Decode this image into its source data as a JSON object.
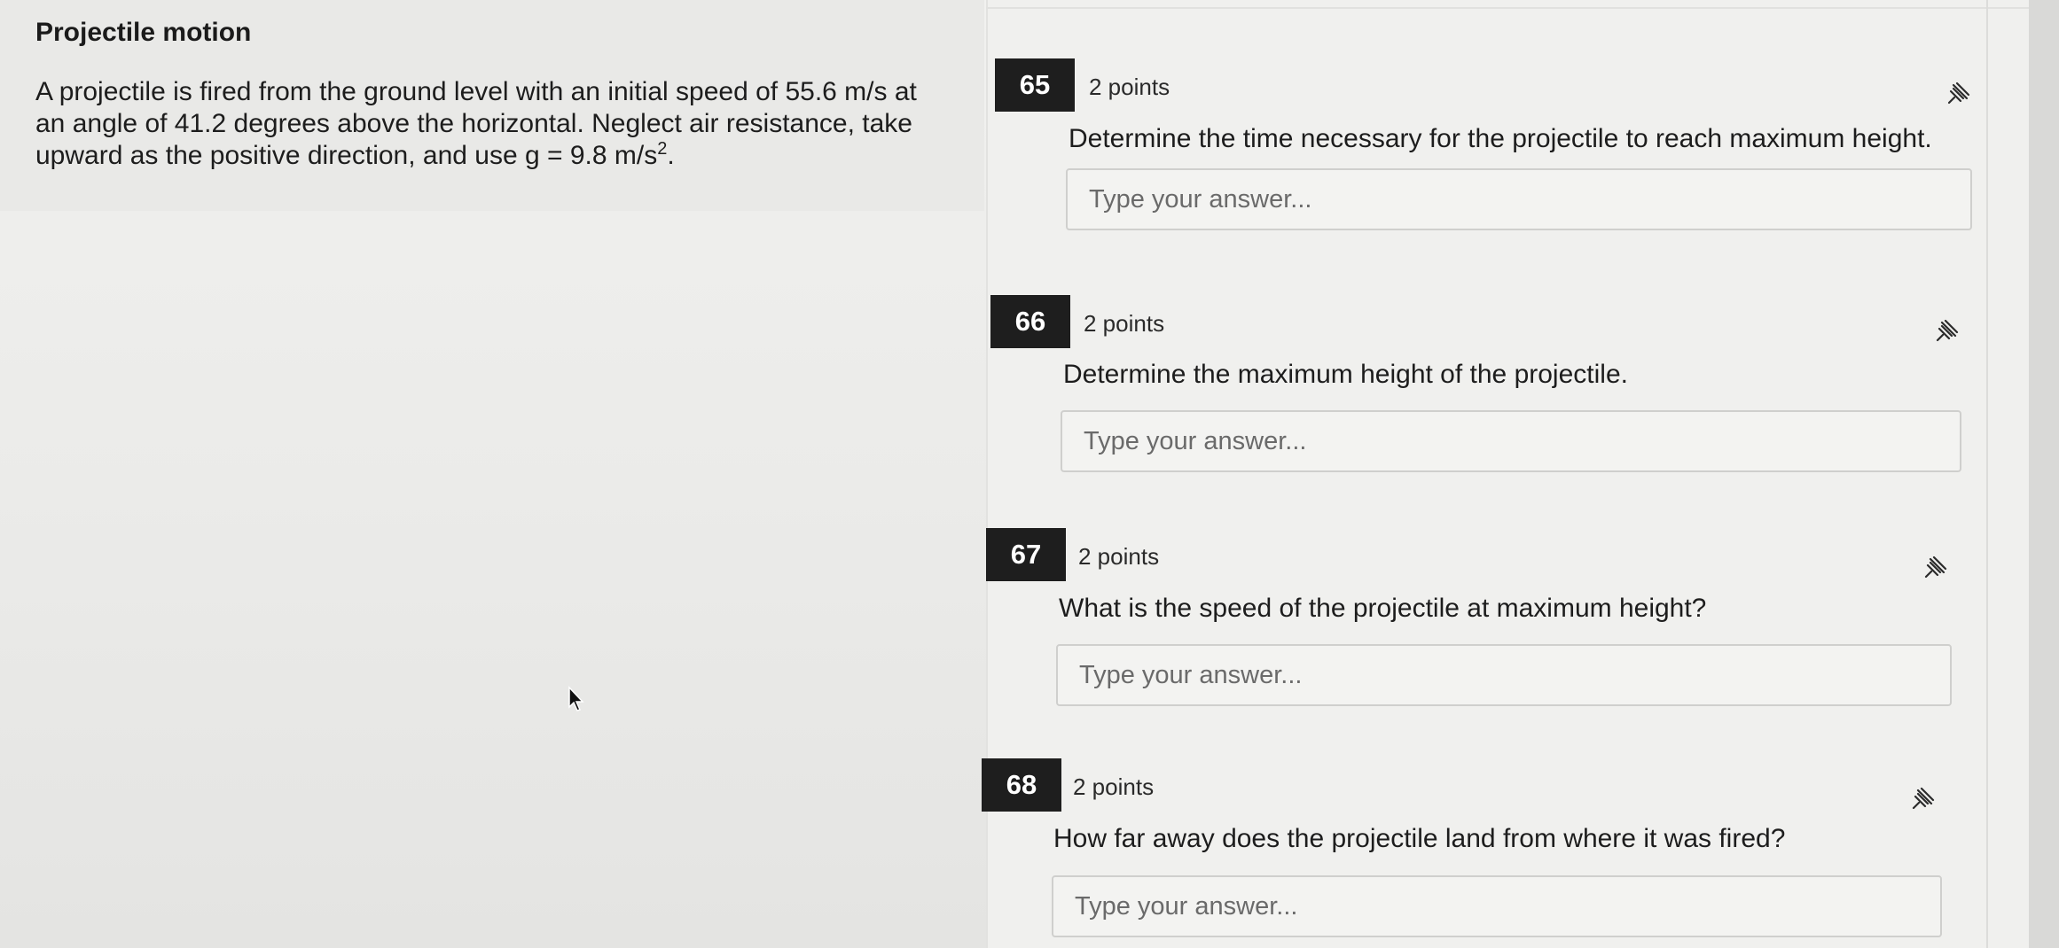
{
  "context": {
    "title": "Projectile motion",
    "text_main": "A projectile is fired from the ground level with an initial speed of 55.6 m/s at an angle of 41.2 degrees above the horizontal. Neglect air resistance, take upward as the positive direction, and use g = 9.8 m/s",
    "exponent": "2",
    "period": "."
  },
  "questions": [
    {
      "number": "65",
      "points": "2 points",
      "text": "Determine the time necessary for the projectile to reach maximum height.",
      "placeholder": "Type your answer...",
      "pin_icon": "pin-icon"
    },
    {
      "number": "66",
      "points": "2 points",
      "text": "Determine the maximum height of the projectile.",
      "placeholder": "Type your answer...",
      "pin_icon": "pin-icon"
    },
    {
      "number": "67",
      "points": "2 points",
      "text": "What is the speed of the projectile at maximum height?",
      "placeholder": "Type your answer...",
      "pin_icon": "pin-icon"
    },
    {
      "number": "68",
      "points": "2 points",
      "text": "How far away does the projectile land from where it was fired?",
      "placeholder": "Type your answer...",
      "pin_icon": "pin-icon"
    }
  ]
}
